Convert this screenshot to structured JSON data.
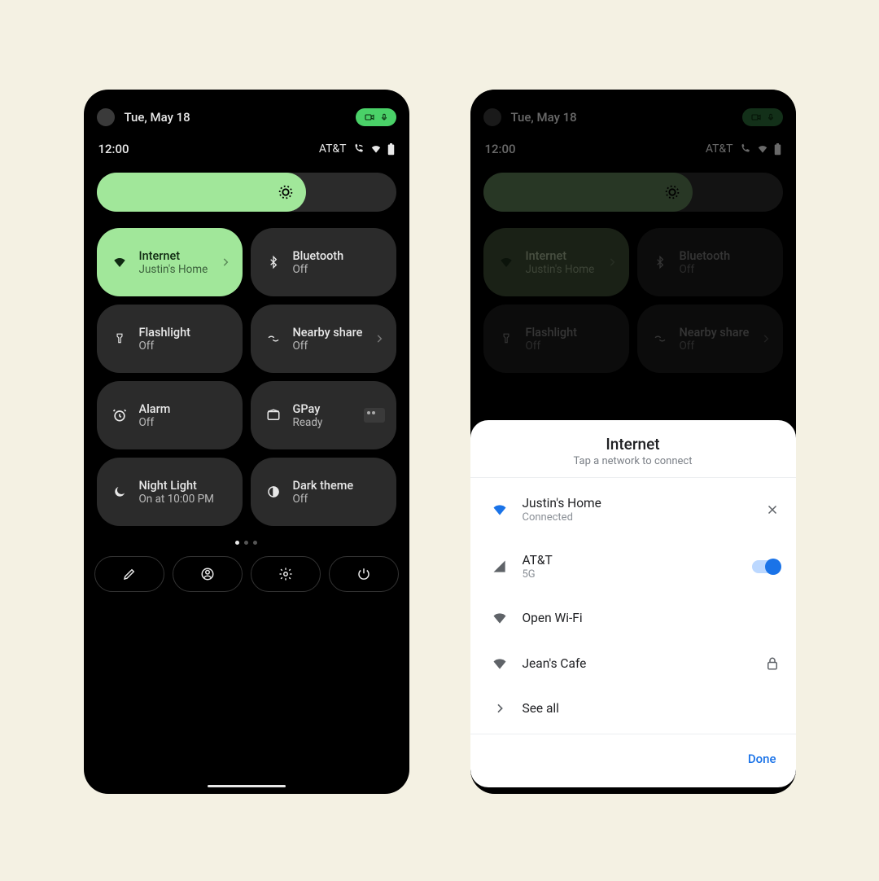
{
  "status": {
    "date": "Tue, May 18",
    "time": "12:00",
    "carrier": "AT&T"
  },
  "brightness": {
    "percent": 70
  },
  "tiles": [
    {
      "title": "Internet",
      "sub": "Justin's Home",
      "icon": "wifi",
      "active": true,
      "chevron": true
    },
    {
      "title": "Bluetooth",
      "sub": "Off",
      "icon": "bluetooth",
      "active": false,
      "chevron": false
    },
    {
      "title": "Flashlight",
      "sub": "Off",
      "icon": "flashlight",
      "active": false,
      "chevron": false
    },
    {
      "title": "Nearby share",
      "sub": "Off",
      "icon": "nearby",
      "active": false,
      "chevron": true
    },
    {
      "title": "Alarm",
      "sub": "Off",
      "icon": "alarm",
      "active": false,
      "chevron": false
    },
    {
      "title": "GPay",
      "sub": "Ready",
      "icon": "wallet",
      "active": false,
      "chevron": false,
      "paycard": true
    },
    {
      "title": "Night Light",
      "sub": "On at 10:00 PM",
      "icon": "moon",
      "active": false,
      "chevron": false
    },
    {
      "title": "Dark theme",
      "sub": "Off",
      "icon": "contrast",
      "active": false,
      "chevron": false
    }
  ],
  "sheet": {
    "title": "Internet",
    "sub": "Tap a network to connect",
    "done": "Done",
    "networks": [
      {
        "name": "Justin's Home",
        "status": "Connected",
        "icon": "wifi-blue",
        "action": "close"
      },
      {
        "name": "AT&T",
        "status": "5G",
        "icon": "cell",
        "action": "switch-on"
      },
      {
        "name": "Open Wi-Fi",
        "status": "",
        "icon": "wifi-grey",
        "action": "none"
      },
      {
        "name": "Jean's Cafe",
        "status": "",
        "icon": "wifi-grey",
        "action": "lock"
      },
      {
        "name": "See all",
        "status": "",
        "icon": "chevron",
        "action": "none"
      }
    ]
  }
}
